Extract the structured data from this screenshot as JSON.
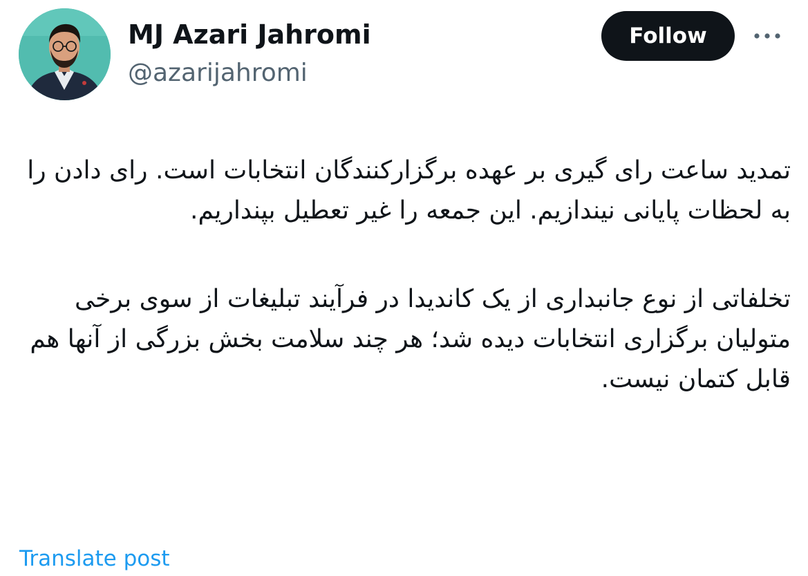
{
  "author": {
    "name": "MJ Azari Jahromi",
    "handle": "@azarijahromi",
    "avatar_icon": "profile-photo"
  },
  "actions": {
    "follow_label": "Follow",
    "more_icon": "more-horizontal-icon"
  },
  "tweet": {
    "paragraphs": [
      "تمدید ساعت رای گیری بر عهده برگزارکنندگان انتخابات است. رای دادن را به لحظات پایانی نیندازیم. این جمعه را غیر تعطیل بپنداریم.",
      "تخلفاتی از نوع جانبداری از یک کاندیدا در فرآیند تبلیغات از سوی برخی متولیان برگزاری انتخابات دیده شد؛ هر چند سلامت بخش بزرگی از آنها هم قابل کتمان نیست."
    ],
    "translate_label": "Translate post"
  },
  "colors": {
    "text_primary": "#0f1419",
    "text_secondary": "#536471",
    "link": "#1d9bf0",
    "follow_bg": "#0f1419",
    "follow_text": "#ffffff",
    "avatar_bg": "#4fb9ad"
  }
}
